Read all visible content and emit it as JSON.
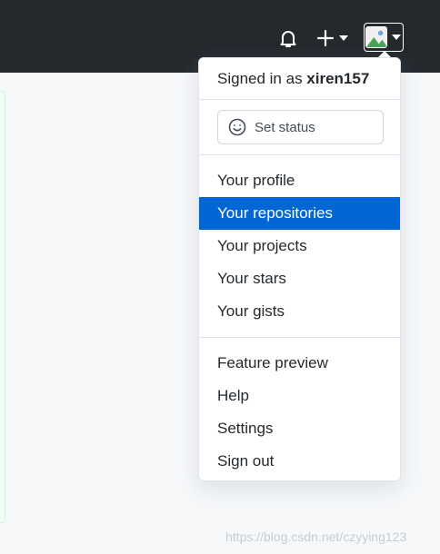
{
  "header": {
    "icons": [
      "bell-icon",
      "plus-icon",
      "caret-down-icon",
      "avatar"
    ]
  },
  "dropdown": {
    "signed_in_prefix": "Signed in as ",
    "username": "xiren157",
    "set_status_label": "Set status",
    "section1": [
      {
        "label": "Your profile",
        "active": false
      },
      {
        "label": "Your repositories",
        "active": true
      },
      {
        "label": "Your projects",
        "active": false
      },
      {
        "label": "Your stars",
        "active": false
      },
      {
        "label": "Your gists",
        "active": false
      }
    ],
    "section2": [
      {
        "label": "Feature preview"
      },
      {
        "label": "Help"
      },
      {
        "label": "Settings"
      },
      {
        "label": "Sign out"
      }
    ]
  },
  "watermark": "https://blog.csdn.net/czyying123",
  "colors": {
    "header_bg": "#24292e",
    "active_bg": "#0366d6"
  }
}
